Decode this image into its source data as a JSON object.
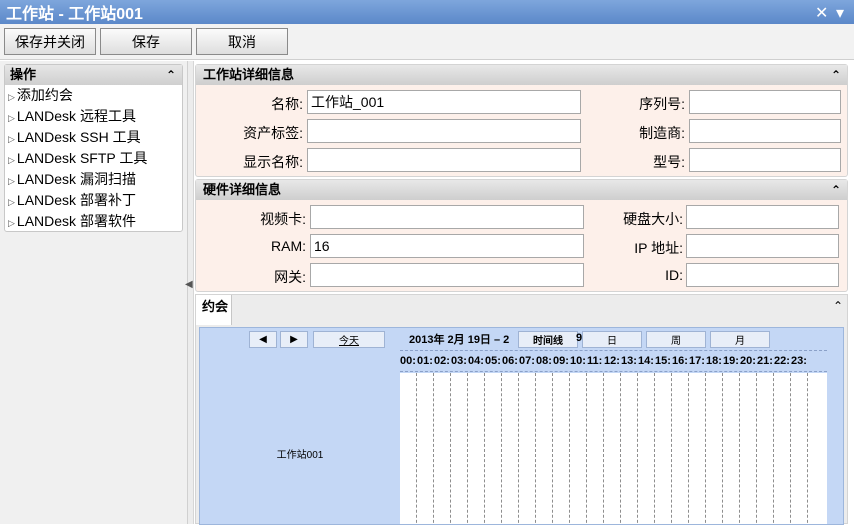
{
  "window": {
    "title": "工作站 - 工作站001",
    "close_glyph": "✕",
    "menu_glyph": "▾"
  },
  "toolbar": {
    "save_close": "保存并关闭",
    "save": "保存",
    "cancel": "取消"
  },
  "ops": {
    "title": "操作",
    "collapse_glyph": "⌃",
    "items": [
      {
        "label": "添加约会"
      },
      {
        "label": "LANDesk 远程工具"
      },
      {
        "label": "LANDesk SSH 工具"
      },
      {
        "label": "LANDesk SFTP 工具"
      },
      {
        "label": "LANDesk 漏洞扫描"
      },
      {
        "label": "LANDesk 部署补丁"
      },
      {
        "label": "LANDesk 部署软件"
      }
    ]
  },
  "workstation": {
    "title": "工作站详细信息",
    "name_label": "名称:",
    "name_value": "工作站_001",
    "asset_label": "资产标签:",
    "asset_value": "",
    "display_label": "显示名称:",
    "display_value": "",
    "serial_label": "序列号:",
    "serial_value": "",
    "maker_label": "制造商:",
    "maker_value": "",
    "model_label": "型号:",
    "model_value": ""
  },
  "hardware": {
    "title": "硬件详细信息",
    "video_label": "视频卡:",
    "video_value": "",
    "ram_label": "RAM:",
    "ram_value": "16",
    "gateway_label": "网关:",
    "gateway_value": "",
    "disk_label": "硬盘大小:",
    "disk_value": "",
    "ip_label": "IP 地址:",
    "ip_value": "",
    "id_label": "ID:",
    "id_value": ""
  },
  "appointments": {
    "tab": "约会",
    "prev": "◀",
    "next": "▶",
    "today": "今天",
    "date": "2013年 2月 19日 – 2",
    "timeline": "时间线",
    "day": "日",
    "week": "周",
    "month": "月",
    "overflow": "9",
    "resource": "工作站001",
    "hours": [
      "00:",
      "01:",
      "02:",
      "03:",
      "04:",
      "05:",
      "06:",
      "07:",
      "08:",
      "09:",
      "10:",
      "11:",
      "12:",
      "13:",
      "14:",
      "15:",
      "16:",
      "17:",
      "18:",
      "19:",
      "20:",
      "21:",
      "22:",
      "23:"
    ]
  }
}
